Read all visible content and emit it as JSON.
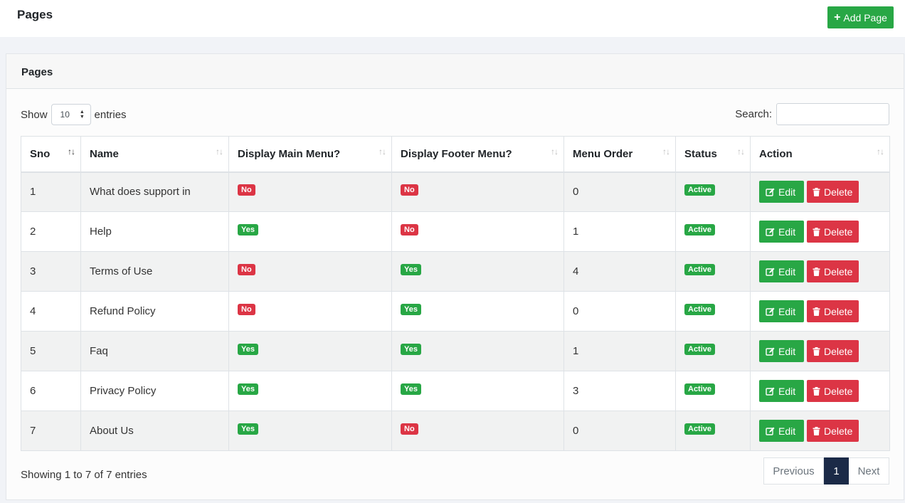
{
  "header": {
    "title": "Pages",
    "add_button": "Add Page"
  },
  "card": {
    "title": "Pages"
  },
  "length": {
    "show_label": "Show",
    "value": "10",
    "entries_label": "entries"
  },
  "search": {
    "label": "Search:",
    "value": ""
  },
  "table": {
    "columns": [
      "Sno",
      "Name",
      "Display Main Menu?",
      "Display Footer Menu?",
      "Menu Order",
      "Status",
      "Action"
    ],
    "rows": [
      {
        "sno": "1",
        "name": "What does support in",
        "main": "No",
        "footer": "No",
        "order": "0",
        "status": "Active",
        "edit": "Edit",
        "delete": "Delete"
      },
      {
        "sno": "2",
        "name": "Help",
        "main": "Yes",
        "footer": "No",
        "order": "1",
        "status": "Active",
        "edit": "Edit",
        "delete": "Delete"
      },
      {
        "sno": "3",
        "name": "Terms of Use",
        "main": "No",
        "footer": "Yes",
        "order": "4",
        "status": "Active",
        "edit": "Edit",
        "delete": "Delete"
      },
      {
        "sno": "4",
        "name": "Refund Policy",
        "main": "No",
        "footer": "Yes",
        "order": "0",
        "status": "Active",
        "edit": "Edit",
        "delete": "Delete"
      },
      {
        "sno": "5",
        "name": "Faq",
        "main": "Yes",
        "footer": "Yes",
        "order": "1",
        "status": "Active",
        "edit": "Edit",
        "delete": "Delete"
      },
      {
        "sno": "6",
        "name": "Privacy Policy",
        "main": "Yes",
        "footer": "Yes",
        "order": "3",
        "status": "Active",
        "edit": "Edit",
        "delete": "Delete"
      },
      {
        "sno": "7",
        "name": "About Us",
        "main": "Yes",
        "footer": "No",
        "order": "0",
        "status": "Active",
        "edit": "Edit",
        "delete": "Delete"
      }
    ]
  },
  "footer": {
    "info": "Showing 1 to 7 of 7 entries",
    "previous": "Previous",
    "current_page": "1",
    "next": "Next"
  },
  "colors": {
    "success": "#28a745",
    "danger": "#dc3545",
    "pager_active": "#1b2a47"
  },
  "icons": {
    "add": "plus-icon",
    "edit": "edit-icon",
    "delete": "trash-icon",
    "sort": "sort-icon"
  }
}
